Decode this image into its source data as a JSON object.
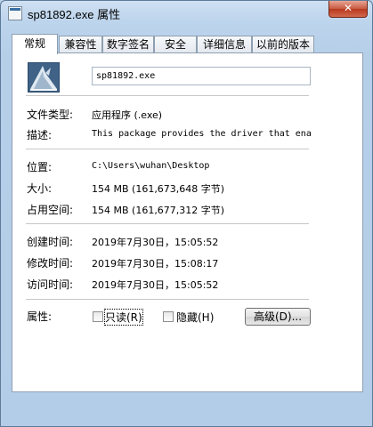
{
  "window": {
    "title": "sp81892.exe 属性",
    "close_glyph": "✕"
  },
  "tabs": [
    {
      "label": "常规",
      "active": true
    },
    {
      "label": "兼容性",
      "active": false
    },
    {
      "label": "数字签名",
      "active": false
    },
    {
      "label": "安全",
      "active": false
    },
    {
      "label": "详细信息",
      "active": false
    },
    {
      "label": "以前的版本",
      "active": false
    }
  ],
  "general": {
    "file_name": "sp81892.exe",
    "file_type_label": "文件类型:",
    "file_type_value": "应用程序 (.exe)",
    "description_label": "描述:",
    "description_value": "This package provides the driver that ena",
    "location_label": "位置:",
    "location_value": "C:\\Users\\wuhan\\Desktop",
    "size_label": "大小:",
    "size_value": "154 MB (161,673,648 字节)",
    "size_on_disk_label": "占用空间:",
    "size_on_disk_value": "154 MB (161,677,312 字节)",
    "created_label": "创建时间:",
    "created_value": "2019年7月30日，15:05:52",
    "modified_label": "修改时间:",
    "modified_value": "2019年7月30日，15:08:17",
    "accessed_label": "访问时间:",
    "accessed_value": "2019年7月30日，15:05:52",
    "attributes_label": "属性:",
    "readonly_label": "只读(R)",
    "readonly_checked": false,
    "hidden_label": "隐藏(H)",
    "hidden_checked": false,
    "advanced_button_label": "高级(D)..."
  },
  "icons": {
    "app": "exe-file-icon",
    "file": "installer-package-icon"
  },
  "colors": {
    "window_frame": "#b3cde8",
    "close_button": "#c75a41",
    "panel_border": "#8e9fb1"
  }
}
